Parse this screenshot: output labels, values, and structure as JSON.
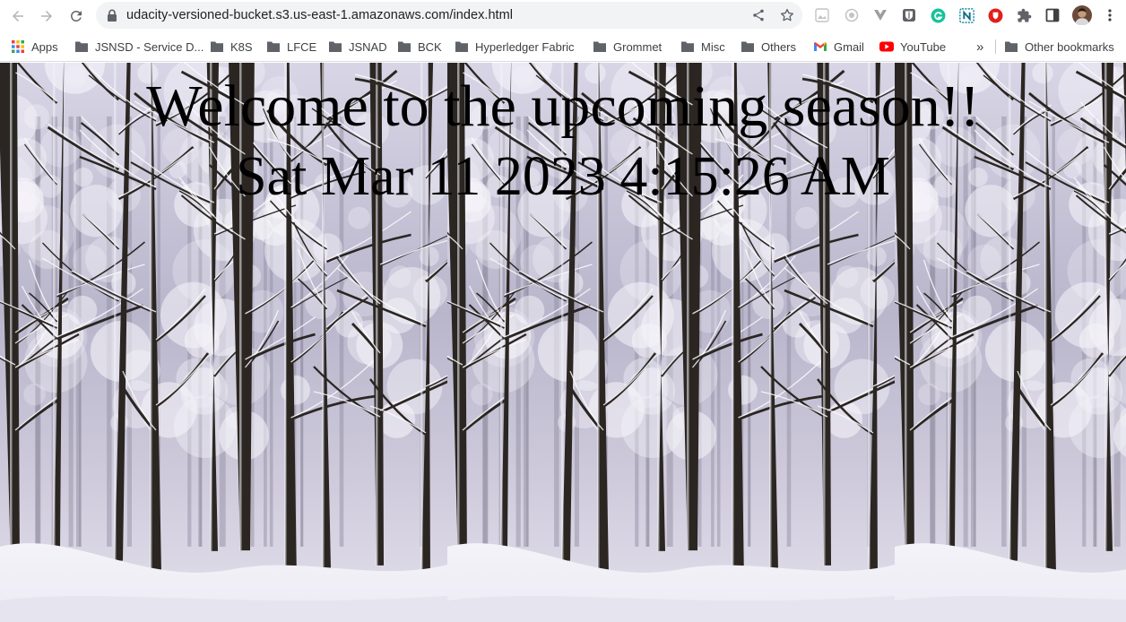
{
  "browser": {
    "url": "udacity-versioned-bucket.s3.us-east-1.amazonaws.com/index.html",
    "icons": {
      "back": "back-arrow-icon",
      "forward": "forward-arrow-icon",
      "reload": "reload-icon",
      "lock": "lock-icon",
      "share": "share-icon",
      "bookmark": "star-icon",
      "extensions": "puzzle-icon",
      "side_panel": "side-panel-icon",
      "menu": "kebab-menu-icon"
    }
  },
  "bookmarks": {
    "items": [
      {
        "label": "Apps",
        "icon": "apps-grid-icon"
      },
      {
        "label": "JSNSD - Service D...",
        "icon": "folder-icon"
      },
      {
        "label": "K8S",
        "icon": "folder-icon"
      },
      {
        "label": "LFCE",
        "icon": "folder-icon"
      },
      {
        "label": "JSNAD",
        "icon": "folder-icon"
      },
      {
        "label": "BCK",
        "icon": "folder-icon"
      },
      {
        "label": "Hyperledger Fabric",
        "icon": "folder-icon"
      },
      {
        "label": "Grommet",
        "icon": "folder-icon"
      },
      {
        "label": "Misc",
        "icon": "folder-icon"
      },
      {
        "label": "Others",
        "icon": "folder-icon"
      },
      {
        "label": "Gmail",
        "icon": "gmail-icon"
      },
      {
        "label": "YouTube",
        "icon": "youtube-icon"
      }
    ],
    "overflow": "»",
    "other": "Other bookmarks"
  },
  "page": {
    "welcome": "Welcome to the upcoming season!!",
    "datetime": "Sat Mar 11 2023 4:15:26 AM"
  },
  "colors": {
    "snow": "#eceaf4",
    "sky": "#b9b6cc",
    "trunk": "#2b2622",
    "gmail_red": "#ea4335",
    "youtube_red": "#ff0000",
    "grammarly_green": "#15c39a"
  }
}
